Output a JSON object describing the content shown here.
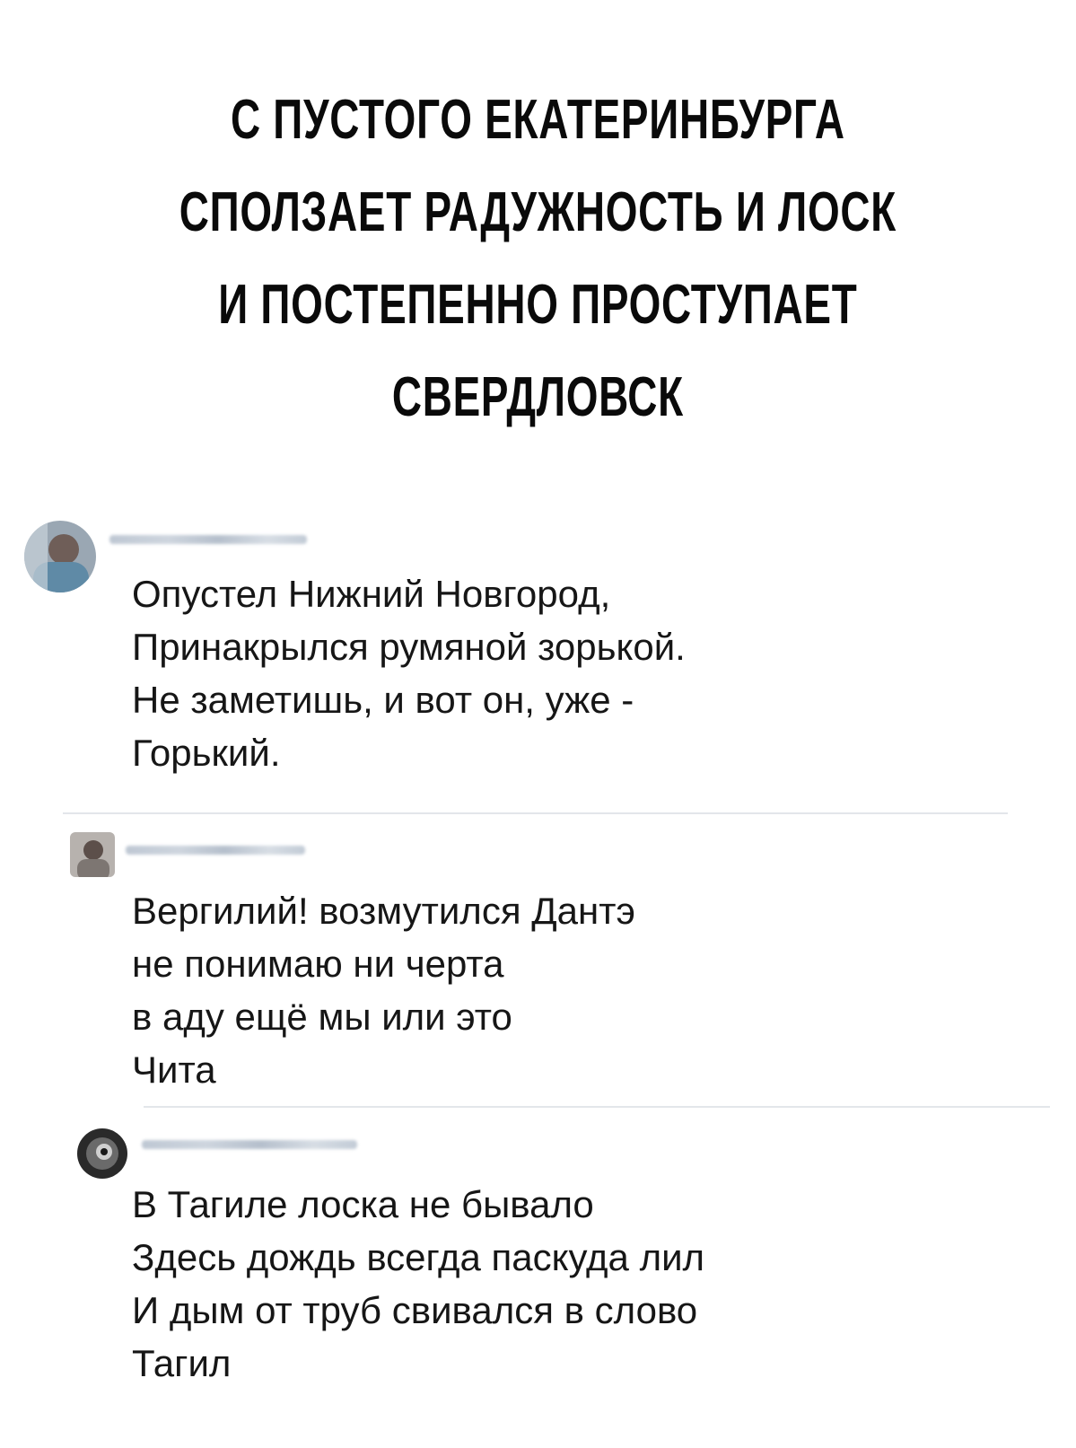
{
  "headline": {
    "lines": [
      "С ПУСТОГО ЕКАТЕРИНБУРГА",
      "СПОЛЗАЕТ РАДУЖНОСТЬ И ЛОСК",
      "И ПОСТЕПЕННО ПРОСТУПАЕТ",
      "СВЕРДЛОВСК"
    ]
  },
  "comments": [
    {
      "author": "",
      "lines": [
        "Опустел Нижний Новгород,",
        "Принакрылся румяной зорькой.",
        "Не заметишь, и вот он, уже -",
        "Горький."
      ]
    },
    {
      "author": "",
      "lines": [
        "Вергилий! возмутился Дантэ",
        "не понимаю ни черта",
        "в аду ещё мы или это",
        "Чита"
      ]
    },
    {
      "author": "",
      "lines": [
        "В Тагиле лоска не бывало",
        "Здесь дождь всегда паскуда лил",
        "И дым от труб свивался в слово",
        "Тагил"
      ]
    }
  ],
  "colors": {
    "text": "#161616",
    "author_blur": "#b8c2cf",
    "divider": "#e3e6ea"
  }
}
